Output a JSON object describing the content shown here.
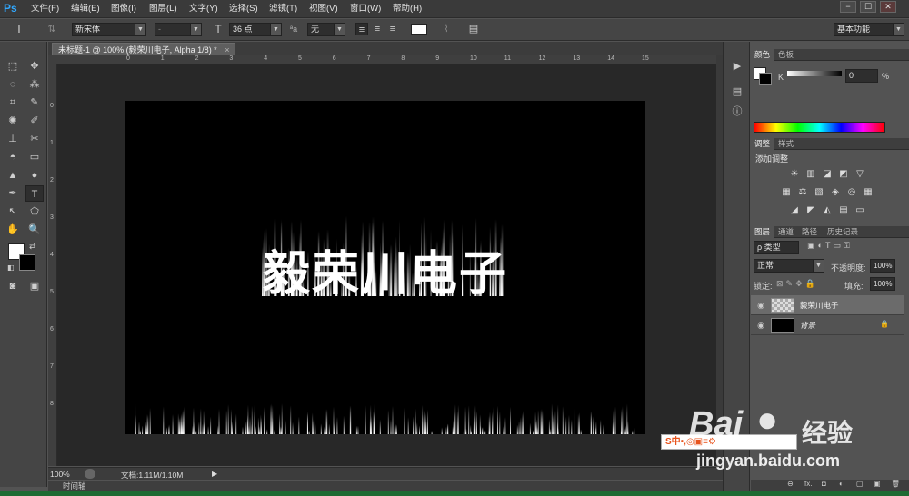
{
  "app": {
    "logo": "Ps"
  },
  "menu": [
    "文件(F)",
    "编辑(E)",
    "图像(I)",
    "图层(L)",
    "文字(Y)",
    "选择(S)",
    "滤镜(T)",
    "视图(V)",
    "窗口(W)",
    "帮助(H)"
  ],
  "window_controls": [
    "−",
    "☐",
    "✕"
  ],
  "options": {
    "tool_glyph": "T",
    "font_family": "新宋体",
    "font_style": "-",
    "size": "36 点",
    "aa_label": "ªa",
    "antialias": "无",
    "workspace": "基本功能"
  },
  "document": {
    "tab_title": "未标题-1 @ 100% (毅荣川电子, Alpha 1/8) *",
    "close_glyph": "×",
    "canvas_text": "毅荣川电子",
    "zoom": "100%",
    "doc_size": "文档:1.11M/1.10M",
    "timeline": "时间轴"
  },
  "rulers": {
    "h": [
      "0",
      "1",
      "2",
      "3",
      "4",
      "5",
      "6",
      "7",
      "8",
      "9",
      "10",
      "11",
      "12",
      "13",
      "14",
      "15"
    ],
    "v": [
      "0",
      "1",
      "2",
      "3",
      "4",
      "5",
      "6",
      "7",
      "8"
    ]
  },
  "tools": [
    [
      "⬚",
      "✥"
    ],
    [
      "◌",
      "⁂"
    ],
    [
      "⌗",
      "✎"
    ],
    [
      "✺",
      "✐"
    ],
    [
      "⊥",
      "✂"
    ],
    [
      "◓",
      "▭"
    ],
    [
      "▲",
      "●"
    ],
    [
      "✒",
      "T"
    ],
    [
      "↖",
      "⬠"
    ],
    [
      "✋",
      "🔍"
    ]
  ],
  "color_panel": {
    "tabs": [
      "颜色",
      "色板"
    ],
    "channel": "K",
    "value": "0",
    "unit": "%"
  },
  "adjust_panel": {
    "tabs": [
      "调整",
      "样式"
    ],
    "title": "添加调整",
    "row1": [
      "☀",
      "▥",
      "◪",
      "◩",
      "▽"
    ],
    "row2": [
      "▦",
      "⚖",
      "▧",
      "◈",
      "◎",
      "▦"
    ],
    "row3": [
      "◢",
      "◤",
      "◭",
      "▤",
      "▭"
    ]
  },
  "layers_panel": {
    "tabs": [
      "图层",
      "通道",
      "路径",
      "历史记录"
    ],
    "filter": "ρ 类型",
    "blend": "正常",
    "opacity_label": "不透明度:",
    "opacity": "100%",
    "lock_label": "锁定:",
    "fill_label": "填充:",
    "fill": "100%",
    "layers": [
      {
        "name": "毅荣川电子",
        "selected": true
      },
      {
        "name": "背景",
        "selected": false,
        "lock": "🔒"
      }
    ],
    "bottom_icons": [
      "⊖",
      "fx.",
      "◘",
      "◐",
      "▢",
      "▣",
      "🗑"
    ]
  },
  "watermark": {
    "brand": "Bai",
    "paw": "●",
    "brand2": "经验",
    "url": "jingyan.baidu.com",
    "ime": "S中•,◎▣≡⚙"
  },
  "colors": {
    "accent": "#31a8ff",
    "canvas": "#000000",
    "panel": "#535353"
  }
}
